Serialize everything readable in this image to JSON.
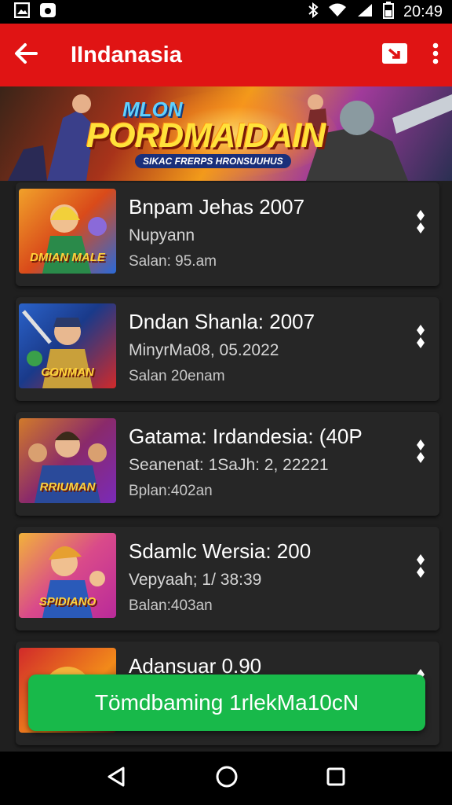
{
  "status_bar": {
    "time": "20:49",
    "icons": [
      "image-icon",
      "gamepad-icon",
      "bluetooth-icon",
      "wifi-icon",
      "signal-icon",
      "battery-icon"
    ]
  },
  "app_bar": {
    "title": "IIndanasia",
    "back_icon": "arrow-back-icon",
    "actions": [
      "cast-icon",
      "more-vert-icon"
    ]
  },
  "banner": {
    "title_top": "MLON",
    "title": "PORDMAIDAIN",
    "subtitle": "SIKAC FRERPS HRONSUUHUS"
  },
  "items": [
    {
      "title": "Bnpam Jehas 2007",
      "subtitle": "Nupyann",
      "meta": "Salan: 95.am",
      "thumb_label": "DMIAN MALE",
      "colors": [
        "#f1a12a",
        "#2a6ad9"
      ]
    },
    {
      "title": "Dndan Shanla: 2007",
      "subtitle": "MinyrMa08, 05.2022",
      "meta": "Salan 20enam",
      "thumb_label": "CONMAN",
      "colors": [
        "#2a62c9",
        "#d12a2a"
      ]
    },
    {
      "title": "Gatama: Irdandesia: (40P",
      "subtitle": "Seanenat: 1SaJh: 2, 22221",
      "meta": "Bplan:402an",
      "thumb_label": "RRIUMAN",
      "colors": [
        "#d17a2a",
        "#7a2ab9"
      ]
    },
    {
      "title": "Sdamlc Wersia: 200",
      "subtitle": "Vepyaah; 1/ 38:39",
      "meta": "Balan:403an",
      "thumb_label": "SPIDIANO",
      "colors": [
        "#f2b23a",
        "#b92a9a"
      ]
    },
    {
      "title": "Adansuar 0.90",
      "subtitle": "",
      "meta": "",
      "thumb_label": "",
      "colors": [
        "#d12a2a",
        "#f28a1a"
      ]
    }
  ],
  "cta": {
    "label": "Tömdbaming 1rlekMa10cN"
  },
  "nav_bar": {
    "icons": [
      "back-triangle-icon",
      "home-circle-icon",
      "recents-square-icon"
    ]
  },
  "theme": {
    "primary": "#e01414",
    "accent": "#18b94a",
    "background": "#1f1f1f",
    "card": "#262626"
  }
}
